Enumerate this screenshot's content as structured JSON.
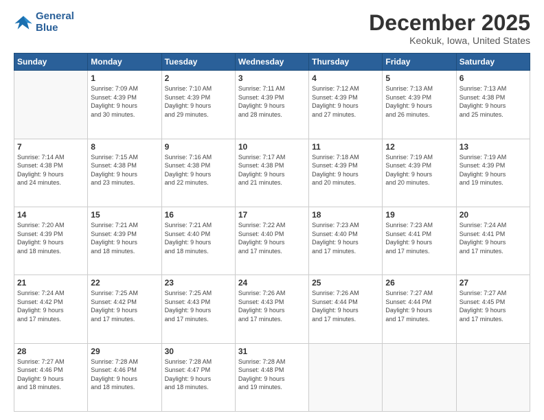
{
  "header": {
    "logo_line1": "General",
    "logo_line2": "Blue",
    "month": "December 2025",
    "location": "Keokuk, Iowa, United States"
  },
  "days_of_week": [
    "Sunday",
    "Monday",
    "Tuesday",
    "Wednesday",
    "Thursday",
    "Friday",
    "Saturday"
  ],
  "weeks": [
    [
      {
        "day": "",
        "info": ""
      },
      {
        "day": "1",
        "info": "Sunrise: 7:09 AM\nSunset: 4:39 PM\nDaylight: 9 hours\nand 30 minutes."
      },
      {
        "day": "2",
        "info": "Sunrise: 7:10 AM\nSunset: 4:39 PM\nDaylight: 9 hours\nand 29 minutes."
      },
      {
        "day": "3",
        "info": "Sunrise: 7:11 AM\nSunset: 4:39 PM\nDaylight: 9 hours\nand 28 minutes."
      },
      {
        "day": "4",
        "info": "Sunrise: 7:12 AM\nSunset: 4:39 PM\nDaylight: 9 hours\nand 27 minutes."
      },
      {
        "day": "5",
        "info": "Sunrise: 7:13 AM\nSunset: 4:39 PM\nDaylight: 9 hours\nand 26 minutes."
      },
      {
        "day": "6",
        "info": "Sunrise: 7:13 AM\nSunset: 4:38 PM\nDaylight: 9 hours\nand 25 minutes."
      }
    ],
    [
      {
        "day": "7",
        "info": "Sunrise: 7:14 AM\nSunset: 4:38 PM\nDaylight: 9 hours\nand 24 minutes."
      },
      {
        "day": "8",
        "info": "Sunrise: 7:15 AM\nSunset: 4:38 PM\nDaylight: 9 hours\nand 23 minutes."
      },
      {
        "day": "9",
        "info": "Sunrise: 7:16 AM\nSunset: 4:38 PM\nDaylight: 9 hours\nand 22 minutes."
      },
      {
        "day": "10",
        "info": "Sunrise: 7:17 AM\nSunset: 4:38 PM\nDaylight: 9 hours\nand 21 minutes."
      },
      {
        "day": "11",
        "info": "Sunrise: 7:18 AM\nSunset: 4:39 PM\nDaylight: 9 hours\nand 20 minutes."
      },
      {
        "day": "12",
        "info": "Sunrise: 7:19 AM\nSunset: 4:39 PM\nDaylight: 9 hours\nand 20 minutes."
      },
      {
        "day": "13",
        "info": "Sunrise: 7:19 AM\nSunset: 4:39 PM\nDaylight: 9 hours\nand 19 minutes."
      }
    ],
    [
      {
        "day": "14",
        "info": "Sunrise: 7:20 AM\nSunset: 4:39 PM\nDaylight: 9 hours\nand 18 minutes."
      },
      {
        "day": "15",
        "info": "Sunrise: 7:21 AM\nSunset: 4:39 PM\nDaylight: 9 hours\nand 18 minutes."
      },
      {
        "day": "16",
        "info": "Sunrise: 7:21 AM\nSunset: 4:40 PM\nDaylight: 9 hours\nand 18 minutes."
      },
      {
        "day": "17",
        "info": "Sunrise: 7:22 AM\nSunset: 4:40 PM\nDaylight: 9 hours\nand 17 minutes."
      },
      {
        "day": "18",
        "info": "Sunrise: 7:23 AM\nSunset: 4:40 PM\nDaylight: 9 hours\nand 17 minutes."
      },
      {
        "day": "19",
        "info": "Sunrise: 7:23 AM\nSunset: 4:41 PM\nDaylight: 9 hours\nand 17 minutes."
      },
      {
        "day": "20",
        "info": "Sunrise: 7:24 AM\nSunset: 4:41 PM\nDaylight: 9 hours\nand 17 minutes."
      }
    ],
    [
      {
        "day": "21",
        "info": "Sunrise: 7:24 AM\nSunset: 4:42 PM\nDaylight: 9 hours\nand 17 minutes."
      },
      {
        "day": "22",
        "info": "Sunrise: 7:25 AM\nSunset: 4:42 PM\nDaylight: 9 hours\nand 17 minutes."
      },
      {
        "day": "23",
        "info": "Sunrise: 7:25 AM\nSunset: 4:43 PM\nDaylight: 9 hours\nand 17 minutes."
      },
      {
        "day": "24",
        "info": "Sunrise: 7:26 AM\nSunset: 4:43 PM\nDaylight: 9 hours\nand 17 minutes."
      },
      {
        "day": "25",
        "info": "Sunrise: 7:26 AM\nSunset: 4:44 PM\nDaylight: 9 hours\nand 17 minutes."
      },
      {
        "day": "26",
        "info": "Sunrise: 7:27 AM\nSunset: 4:44 PM\nDaylight: 9 hours\nand 17 minutes."
      },
      {
        "day": "27",
        "info": "Sunrise: 7:27 AM\nSunset: 4:45 PM\nDaylight: 9 hours\nand 17 minutes."
      }
    ],
    [
      {
        "day": "28",
        "info": "Sunrise: 7:27 AM\nSunset: 4:46 PM\nDaylight: 9 hours\nand 18 minutes."
      },
      {
        "day": "29",
        "info": "Sunrise: 7:28 AM\nSunset: 4:46 PM\nDaylight: 9 hours\nand 18 minutes."
      },
      {
        "day": "30",
        "info": "Sunrise: 7:28 AM\nSunset: 4:47 PM\nDaylight: 9 hours\nand 18 minutes."
      },
      {
        "day": "31",
        "info": "Sunrise: 7:28 AM\nSunset: 4:48 PM\nDaylight: 9 hours\nand 19 minutes."
      },
      {
        "day": "",
        "info": ""
      },
      {
        "day": "",
        "info": ""
      },
      {
        "day": "",
        "info": ""
      }
    ]
  ]
}
